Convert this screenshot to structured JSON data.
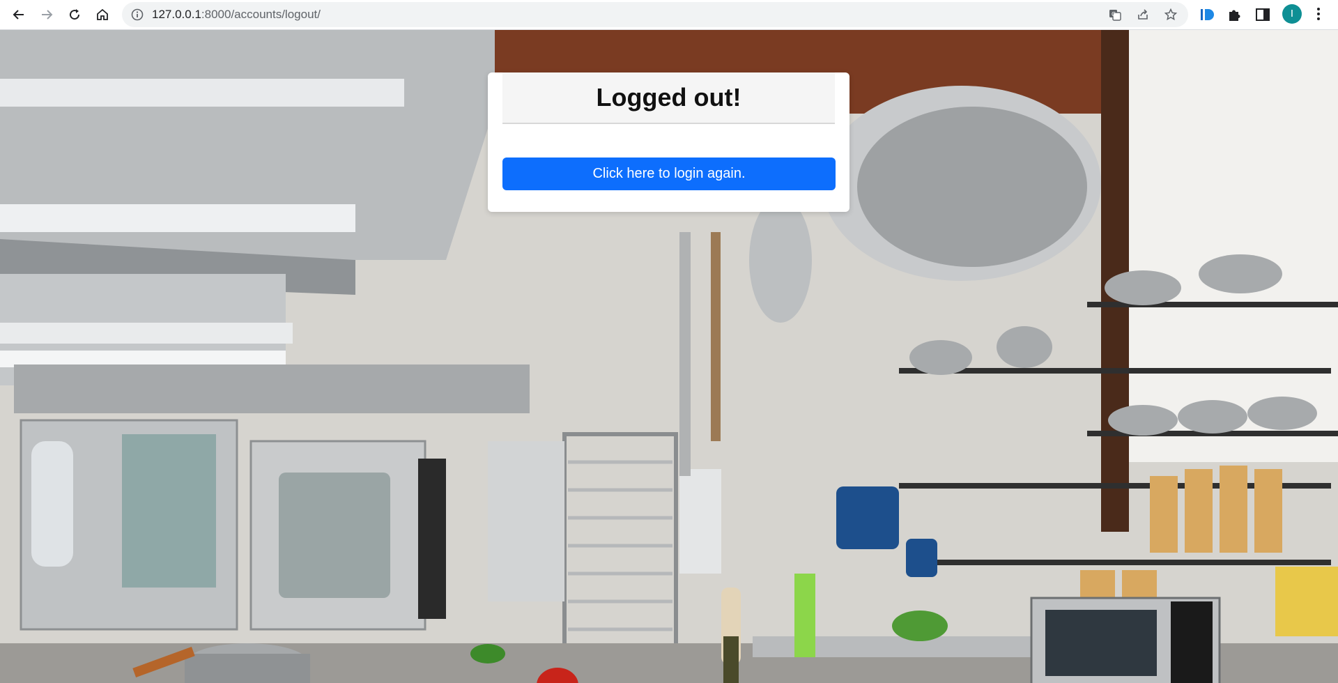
{
  "browser": {
    "url_host": "127.0.0.1",
    "url_rest": ":8000/accounts/logout/",
    "avatar_letter": "I"
  },
  "page": {
    "title": "Logged out!",
    "login_button_label": "Click here to login again."
  },
  "icons": {
    "back": "back-arrow-icon",
    "forward": "forward-arrow-icon",
    "reload": "reload-icon",
    "home": "home-icon",
    "site_info": "site-info-icon",
    "translate": "translate-icon",
    "share": "share-icon",
    "bookmark": "star-icon",
    "extension_id": "id-extension-icon",
    "extensions": "puzzle-icon",
    "side_panel": "side-panel-icon",
    "menu": "more-vert-icon"
  },
  "colors": {
    "primary_button": "#0d6efd",
    "avatar": "#0e8f94"
  }
}
